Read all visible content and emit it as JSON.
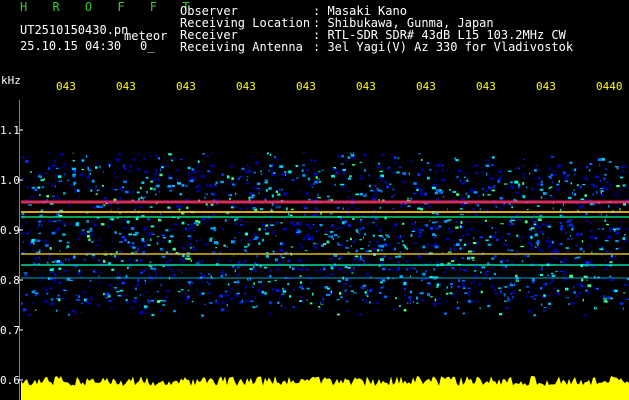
{
  "app": {
    "title": "H R O F F T",
    "file_name": "UT2510150430.pn",
    "file_suffix": "meteor",
    "datetime": "25.10.15 04:30",
    "extra": "0_"
  },
  "info": [
    {
      "label": "Observer",
      "value": ": Masaki Kano"
    },
    {
      "label": "Receiving Location",
      "value": ": Shibukawa, Gunma, Japan"
    },
    {
      "label": "Receiver",
      "value": ": RTL-SDR SDR# 43dB L15 103.2MHz CW"
    },
    {
      "label": "Receiving Antenna",
      "value": ": 3el Yagi(V) Az 330 for Vladivostok"
    }
  ],
  "axis": {
    "unit": "kHz",
    "y_ticks": [
      "1.1",
      "1.0",
      "0.9",
      "0.8",
      "0.7",
      "0.6"
    ],
    "time_ticks": [
      "043",
      "043",
      "043",
      "043",
      "043",
      "043",
      "043",
      "043",
      "043",
      "0440"
    ]
  },
  "colors": {
    "title": "#33cc33",
    "text": "#ffffff",
    "ticks": "#ffff00",
    "noise_low": "#0000c0",
    "noise_high": "#00ffff",
    "signal": "#ff3366",
    "amplitude": "#ffff00"
  }
}
